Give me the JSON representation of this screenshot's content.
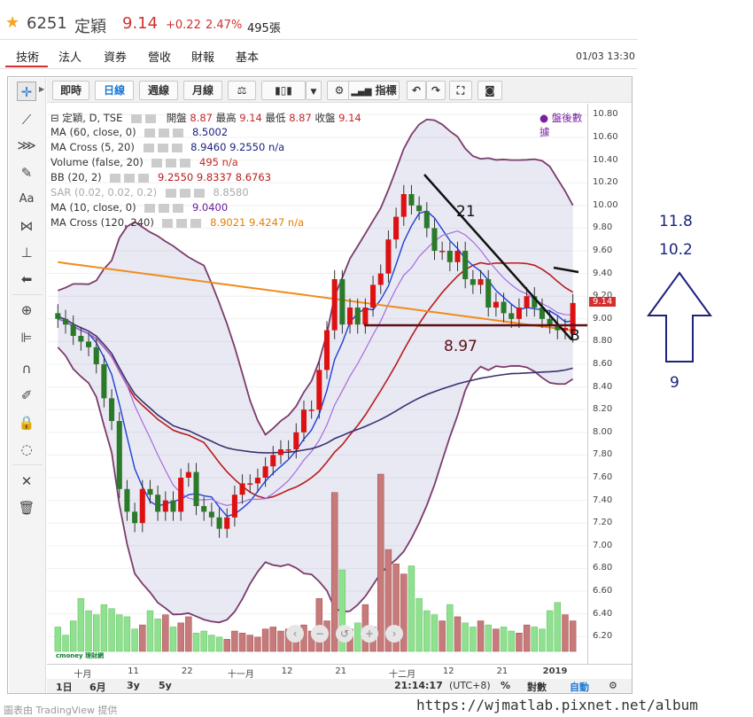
{
  "header": {
    "star_icon": "star-icon",
    "code": "6251",
    "name": "定穎",
    "price": "9.14",
    "change": "+0.22",
    "change_pct": "2.47%",
    "volume": "495張",
    "price_color": "#d32f2f"
  },
  "tabs": [
    "技術",
    "法人",
    "資券",
    "營收",
    "財報",
    "基本"
  ],
  "active_tab": "技術",
  "datetime": "01/03 13:30",
  "toolbar": {
    "realtime": "即時",
    "daily": "日線",
    "weekly": "週線",
    "monthly": "月線",
    "indicators": "指標"
  },
  "legend": {
    "symbol": "定穎, D, TSE",
    "open_label": "開盤",
    "open": "8.87",
    "high_label": "最高",
    "high": "9.14",
    "low_label": "最低",
    "low": "8.87",
    "close_label": "收盤",
    "close": "9.14",
    "after_hours": "盤後數據",
    "rows": [
      {
        "name": "MA (60, close, 0)",
        "values": "8.5002"
      },
      {
        "name": "MA Cross (5, 20)",
        "values": "8.9460 9.2550 n/a"
      },
      {
        "name": "Volume (false, 20)",
        "values": "495 n/a"
      },
      {
        "name": "BB (20, 2)",
        "values": "9.2550 9.8337 8.6763"
      },
      {
        "name": "SAR (0.02, 0.02, 0.2)",
        "values": "8.8580"
      },
      {
        "name": "MA (10, close, 0)",
        "values": "9.0400"
      },
      {
        "name": "MA Cross (120, 240)",
        "values": "8.9021 9.4247 n/a"
      }
    ]
  },
  "annotations": {
    "label_21": "21",
    "label_897": "8.97",
    "label_B": "B"
  },
  "y_ticks": [
    "10.80",
    "10.60",
    "10.40",
    "10.20",
    "10.00",
    "9.80",
    "9.60",
    "9.40",
    "9.20",
    "9.00",
    "8.80",
    "8.60",
    "8.40",
    "8.20",
    "8.00",
    "7.80",
    "7.60",
    "7.40",
    "7.20",
    "7.00",
    "6.80",
    "6.60",
    "6.40",
    "6.20"
  ],
  "current_price_tag": "9.14",
  "x_ticks": [
    "十月",
    "11",
    "22",
    "十一月",
    "12",
    "21",
    "十二月",
    "12",
    "21",
    "2019"
  ],
  "bottom": {
    "r1d": "1日",
    "r6m": "6月",
    "r3y": "3y",
    "r5y": "5y",
    "time": "21:14:17",
    "tz": "(UTC+8)",
    "pct": "%",
    "log": "對數",
    "auto": "自動",
    "logo_text": "cmoney 理財網"
  },
  "side_notes": {
    "top": "11.8",
    "mid": "10.2",
    "bottom": "9",
    "color": "#1a237e"
  },
  "watermark": "https://wjmatlab.pixnet.net/album",
  "footer": "圖表由 TradingView 提供",
  "chart_data": {
    "type": "candlestick",
    "ylim": [
      6.1,
      10.85
    ],
    "x": [
      "09-27",
      "09-28",
      "10-01",
      "10-02",
      "10-03",
      "10-04",
      "10-05",
      "10-08",
      "10-09",
      "10-11",
      "10-12",
      "10-15",
      "10-16",
      "10-17",
      "10-18",
      "10-19",
      "10-22",
      "10-23",
      "10-24",
      "10-25",
      "10-26",
      "10-29",
      "10-30",
      "10-31",
      "11-01",
      "11-02",
      "11-05",
      "11-06",
      "11-07",
      "11-08",
      "11-09",
      "11-12",
      "11-13",
      "11-14",
      "11-15",
      "11-16",
      "11-19",
      "11-20",
      "11-21",
      "11-22",
      "11-23",
      "11-26",
      "11-27",
      "11-28",
      "11-29",
      "11-30",
      "12-03",
      "12-04",
      "12-05",
      "12-06",
      "12-07",
      "12-10",
      "12-11",
      "12-12",
      "12-13",
      "12-14",
      "12-17",
      "12-18",
      "12-19",
      "12-20",
      "12-21",
      "12-24",
      "12-25",
      "12-26",
      "12-27",
      "12-28",
      "01-02",
      "01-03"
    ],
    "open": [
      9.05,
      9.0,
      8.95,
      8.85,
      8.8,
      8.75,
      8.6,
      8.3,
      8.1,
      7.5,
      7.3,
      7.2,
      7.5,
      7.45,
      7.3,
      7.4,
      7.3,
      7.6,
      7.65,
      7.35,
      7.3,
      7.25,
      7.15,
      7.25,
      7.45,
      7.55,
      7.55,
      7.6,
      7.7,
      7.8,
      7.85,
      7.85,
      8.0,
      8.2,
      8.2,
      8.55,
      8.9,
      9.35,
      8.95,
      9.1,
      8.95,
      9.1,
      9.3,
      9.4,
      9.7,
      9.9,
      10.1,
      10.0,
      9.95,
      9.8,
      9.6,
      9.6,
      9.5,
      9.6,
      9.35,
      9.3,
      9.35,
      9.1,
      9.15,
      9.05,
      9.0,
      9.1,
      9.2,
      9.1,
      9.0,
      8.95,
      8.9,
      8.87
    ],
    "close": [
      9.0,
      8.95,
      8.85,
      8.8,
      8.75,
      8.6,
      8.3,
      8.1,
      7.5,
      7.3,
      7.2,
      7.5,
      7.45,
      7.3,
      7.4,
      7.3,
      7.6,
      7.65,
      7.35,
      7.3,
      7.25,
      7.15,
      7.25,
      7.45,
      7.55,
      7.55,
      7.6,
      7.7,
      7.8,
      7.85,
      7.85,
      8.0,
      8.2,
      8.2,
      8.55,
      8.9,
      9.35,
      8.95,
      9.1,
      8.95,
      9.1,
      9.3,
      9.4,
      9.7,
      9.9,
      10.1,
      10.0,
      9.95,
      9.8,
      9.6,
      9.6,
      9.5,
      9.6,
      9.35,
      9.3,
      9.35,
      9.1,
      9.15,
      9.05,
      9.0,
      9.1,
      9.2,
      9.1,
      9.0,
      8.95,
      8.9,
      8.92,
      9.14
    ],
    "volume": [
      120,
      80,
      150,
      260,
      200,
      180,
      230,
      210,
      180,
      170,
      110,
      130,
      200,
      160,
      180,
      120,
      140,
      170,
      90,
      100,
      80,
      70,
      60,
      100,
      90,
      80,
      70,
      110,
      120,
      100,
      110,
      90,
      130,
      100,
      260,
      150,
      780,
      400,
      110,
      140,
      230,
      120,
      870,
      500,
      430,
      380,
      420,
      260,
      200,
      180,
      150,
      230,
      170,
      140,
      120,
      150,
      130,
      110,
      120,
      100,
      90,
      130,
      120,
      110,
      200,
      240,
      180,
      150
    ],
    "series": [
      {
        "name": "MA (60, close, 0)"
      },
      {
        "name": "MA Cross (5, 20)"
      },
      {
        "name": "BB (20, 2)"
      },
      {
        "name": "MA (10, close, 0)"
      },
      {
        "name": "MA Cross (120, 240)"
      }
    ]
  }
}
